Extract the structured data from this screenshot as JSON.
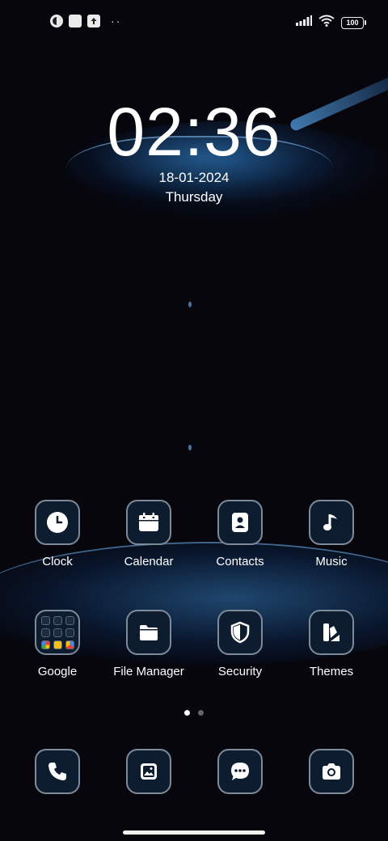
{
  "status_bar": {
    "left_icons": [
      "app-notification-icon",
      "square-notification-icon",
      "upload-icon"
    ],
    "more": "··",
    "battery": "100"
  },
  "lock_clock": {
    "time": "02:36",
    "date": "18-01-2024",
    "day": "Thursday"
  },
  "apps_row1": [
    {
      "label": "Clock",
      "icon": "clock-icon"
    },
    {
      "label": "Calendar",
      "icon": "calendar-icon"
    },
    {
      "label": "Contacts",
      "icon": "contacts-icon"
    },
    {
      "label": "Music",
      "icon": "music-icon"
    }
  ],
  "apps_row2": [
    {
      "label": "Google",
      "icon": "google-folder-icon"
    },
    {
      "label": "File Manager",
      "icon": "folder-icon"
    },
    {
      "label": "Security",
      "icon": "shield-icon"
    },
    {
      "label": "Themes",
      "icon": "themes-icon"
    }
  ],
  "dock": [
    {
      "icon": "phone-icon"
    },
    {
      "icon": "gallery-icon"
    },
    {
      "icon": "messages-icon"
    },
    {
      "icon": "camera-icon"
    }
  ],
  "pages": {
    "count": 2,
    "active": 1
  },
  "colors": {
    "background": "#06060c",
    "icon_bg": "#0d1d2f",
    "icon_border": "#7f8a98",
    "accent_water": "#3c96e6"
  }
}
